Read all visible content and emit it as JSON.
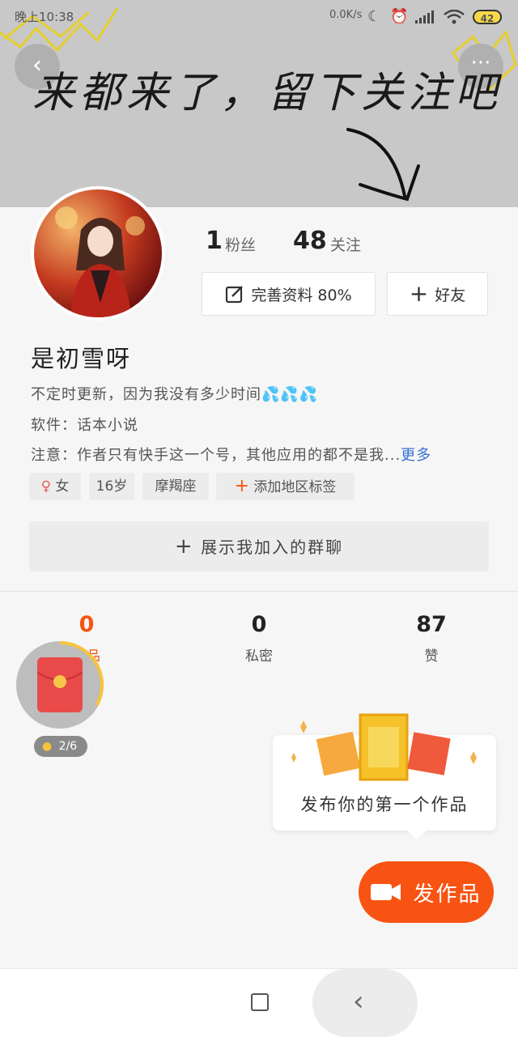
{
  "status_bar": {
    "time": "晚上10:38",
    "net_speed": "0.0K/s",
    "battery": "42"
  },
  "header": {
    "title_text": "来都来了，留下关注吧",
    "back_icon": "chevron-left-icon",
    "more_icon": "more-dots-icon"
  },
  "profile": {
    "avatar_icon": "avatar-illustration",
    "fans_count": "1",
    "fans_label": "粉丝",
    "following_count": "48",
    "following_label": "关注",
    "edit_profile_label": "完善资料 80%",
    "add_friend_label": "好友",
    "name": "是初雪呀",
    "bio": [
      "不定时更新，因为我没有多少时间💦💦💦",
      "软件：话本小说",
      "注意：作者只有快手这一个号，其他应用的都不是我..."
    ],
    "bio_more": "更多",
    "tags": {
      "gender": "女",
      "age": "16岁",
      "zodiac": "摩羯座",
      "add_region": "添加地区标签"
    },
    "group_button": "展示我加入的群聊"
  },
  "tabs": [
    {
      "count": "0",
      "label": "作品",
      "active": true
    },
    {
      "count": "0",
      "label": "私密",
      "active": false
    },
    {
      "count": "87",
      "label": "赞",
      "active": false
    }
  ],
  "redpack": {
    "progress_text": "2/6",
    "progress_fraction": 0.33
  },
  "publish_tip": {
    "text": "发布你的第一个作品"
  },
  "fab": {
    "label": "发作品"
  },
  "colors": {
    "accent": "#f75413",
    "header_bg": "#c8c8c8",
    "link": "#3a6ed6",
    "tag_bg": "#ececec"
  }
}
